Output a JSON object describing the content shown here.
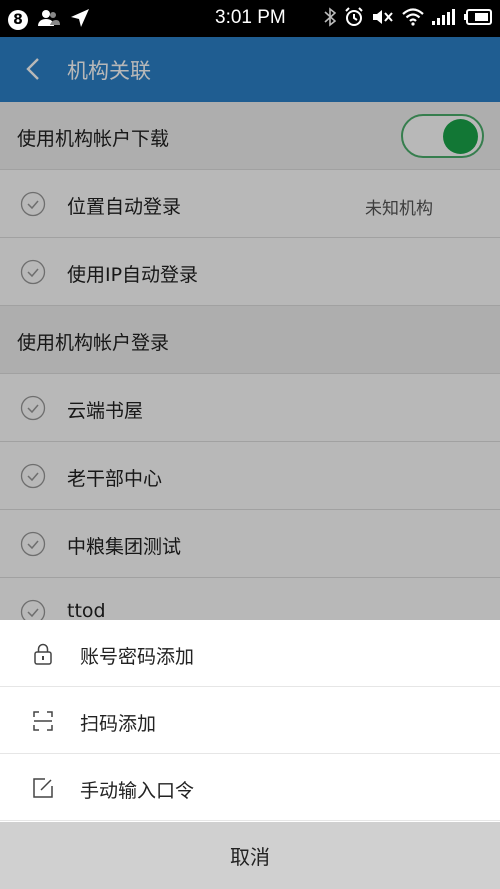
{
  "status_bar": {
    "badge": "8",
    "time": "3:01 PM"
  },
  "app_bar": {
    "title": "机构关联"
  },
  "list": {
    "institution_download_label": "使用机构帐户下载",
    "institution_download_enabled": true,
    "auto_login_location_label": "位置自动登录",
    "auto_login_location_value": "未知机构",
    "auto_login_ip_label": "使用IP自动登录",
    "institution_login_section": "使用机构帐户登录",
    "institutions": [
      "云端书屋",
      "老干部中心",
      "中粮集团测试",
      "ttod"
    ]
  },
  "sheet": {
    "items": [
      {
        "label": "账号密码添加",
        "icon": "lock-icon"
      },
      {
        "label": "扫码添加",
        "icon": "scan-icon"
      },
      {
        "label": "手动输入口令",
        "icon": "edit-icon"
      }
    ],
    "cancel_label": "取消"
  },
  "colors": {
    "app_bar": "#2c82c9",
    "toggle_on": "#19a64a"
  }
}
